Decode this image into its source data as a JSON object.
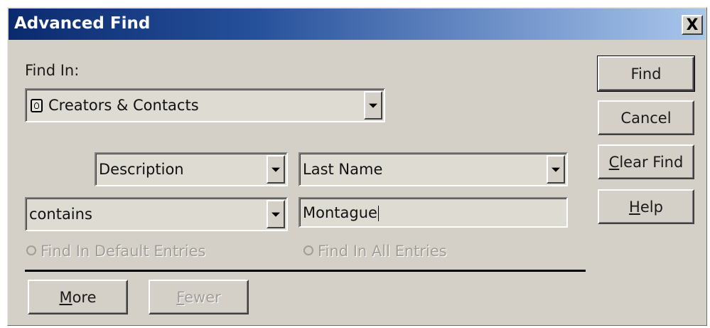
{
  "window": {
    "title": "Advanced Find",
    "close_label": "X"
  },
  "find_in": {
    "label": "Find In:",
    "selected": "Creators & Contacts",
    "icon": "contact-card-icon"
  },
  "criteria": {
    "field_type": "Description",
    "field_name": "Last Name",
    "operator": "contains",
    "value": "Montague"
  },
  "options": {
    "default_entries": "Find In Default Entries",
    "all_entries": "Find In All Entries"
  },
  "buttons": {
    "find": "Find",
    "cancel": "Cancel",
    "clear_find": {
      "underline": "C",
      "rest": "lear Find"
    },
    "help": {
      "underline": "H",
      "rest": "elp"
    },
    "more": {
      "underline": "M",
      "rest": "ore"
    },
    "fewer": {
      "underline": "F",
      "rest": "ewer"
    }
  }
}
